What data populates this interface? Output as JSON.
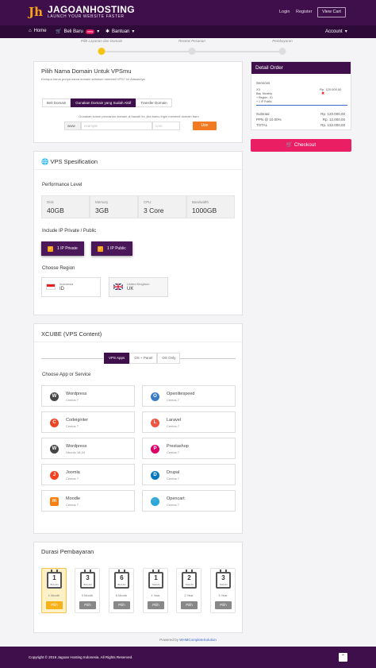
{
  "brand": {
    "name_a": "JAGOAN",
    "name_b": "HOSTING",
    "tagline": "LAUNCH YOUR WEBSITE FASTER"
  },
  "header": {
    "login": "Login",
    "register": "Register",
    "cart": "View Cart"
  },
  "nav": {
    "home": "Home",
    "beli": "Beli Baru",
    "new_badge": "new",
    "bantuan": "Bantuan",
    "account": "Account"
  },
  "steps": {
    "labels": [
      "Pilih Layanan dan Domain",
      "Review Pesanan",
      "Pembayaran"
    ]
  },
  "domain": {
    "title": "Pilih Nama Domain Untuk VPSmu",
    "subtitle": "Kenapa harus punya nama domain sebelum membeli VPS? ini Alasannya",
    "tabs": [
      "Beli Domain",
      "Gunakan Domain yang Sudah Aktif",
      "Transfer Domain"
    ],
    "hint": "Gunakan kolom pencarian domain di bawah ini, jika kamu ingin membeli domain baru",
    "www": "www",
    "placeholder": "example",
    "tld_placeholder": "com",
    "use_btn": "Use"
  },
  "spec": {
    "title": "VPS Spesification",
    "perf_label": "Performance Level",
    "boxes": [
      {
        "label": "Disk",
        "value": "40GB"
      },
      {
        "label": "Memory",
        "value": "3GB"
      },
      {
        "label": "CPU",
        "value": "3 Core"
      },
      {
        "label": "Bandwidth",
        "value": "1000GB"
      }
    ],
    "ip_label": "Include IP Private / Public",
    "ip_private": "1 IP Private",
    "ip_public": "1 IP Public",
    "region_label": "Choose Region",
    "regions": [
      {
        "name": "Indonesia",
        "code": "ID"
      },
      {
        "name": "United Kingdom",
        "code": "UK"
      }
    ]
  },
  "xcube": {
    "title": "XCUBE (VPS Content)",
    "tabs": [
      "VPS Apps",
      "OS + Panel",
      "OS Only"
    ],
    "choose": "Choose App or Service",
    "apps": [
      {
        "name": "Wordpress",
        "os": "Centos 7"
      },
      {
        "name": "Openlitespeed",
        "os": "Centos 7"
      },
      {
        "name": "Codeigniter",
        "os": "Centos 7"
      },
      {
        "name": "Laravel",
        "os": "Centos 7"
      },
      {
        "name": "Wordpress",
        "os": "Ubuntu 18.04"
      },
      {
        "name": "Prestashop",
        "os": "Centos 7"
      },
      {
        "name": "Joomla",
        "os": "Centos 7"
      },
      {
        "name": "Drupal",
        "os": "Centos 7"
      },
      {
        "name": "Moodle",
        "os": "Centos 7"
      },
      {
        "name": "Opencart",
        "os": "Centos 7"
      }
    ]
  },
  "durasi": {
    "title": "Durasi Pembayaran",
    "items": [
      {
        "num": "1",
        "unit": "BULAN",
        "label": "1 Month",
        "btn": "Pilih"
      },
      {
        "num": "3",
        "unit": "BULAN",
        "label": "3 Month",
        "btn": "Pilih"
      },
      {
        "num": "6",
        "unit": "BULAN",
        "label": "6 Month",
        "btn": "Pilih"
      },
      {
        "num": "1",
        "unit": "TAHUN",
        "label": "1 Year",
        "btn": "Pilih"
      },
      {
        "num": "2",
        "unit": "TAHUN",
        "label": "2 Year",
        "btn": "Pilih"
      },
      {
        "num": "3",
        "unit": "TAHUN",
        "label": "3 Year",
        "btn": "Pilih"
      }
    ]
  },
  "order": {
    "title": "Detail Order",
    "services": "Services",
    "item": "X3",
    "item_price": "Rp. 120.000,00",
    "line1": "Bay. Monthly",
    "line2": "+ Region - ID",
    "line3": "+ 1 IP Public",
    "subtotal_l": "Subtotal",
    "subtotal_v": "Rp. 120.000,00",
    "ppn_l": "PPN @ 10.00%",
    "ppn_v": "Rp. 12.000,00",
    "total_l": "TOTAL",
    "total_v": "Rp. 132.000,00"
  },
  "checkout": "Checkout",
  "powered_pre": "Powered by ",
  "powered_link": "WHMCompleteSolution",
  "footer": {
    "copy": "Copyright © 2019 Jagoan Hosting Indonesia. All Rights Reserved."
  },
  "colors": {
    "brand": "#3e0f4a",
    "accent": "#f7a21b",
    "checkout": "#e91e63",
    "use": "#f27b21"
  }
}
